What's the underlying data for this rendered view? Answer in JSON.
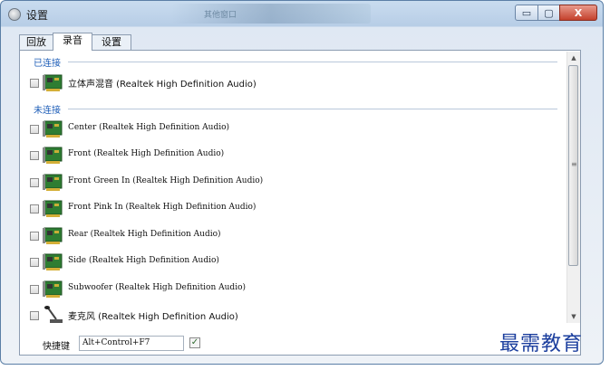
{
  "window": {
    "title": "设置",
    "blurred_title": "其他窗口"
  },
  "controls": {
    "minimize": "▭",
    "maximize": "▢",
    "close": "X"
  },
  "tabs": [
    {
      "label": "回放",
      "active": false
    },
    {
      "label": "录音",
      "active": true
    },
    {
      "label": "设置",
      "active": false
    }
  ],
  "groups": {
    "connected": "已连接",
    "disconnected": "未连接"
  },
  "devices": {
    "connected": [
      {
        "label": "立体声混音 (Realtek High Definition Audio)",
        "icon": "sound-card-icon"
      }
    ],
    "disconnected": [
      {
        "label": "Center (Realtek High Definition Audio)",
        "icon": "sound-card-icon"
      },
      {
        "label": "Front (Realtek High Definition Audio)",
        "icon": "sound-card-icon"
      },
      {
        "label": "Front Green In (Realtek High Definition Audio)",
        "icon": "sound-card-icon"
      },
      {
        "label": "Front Pink In (Realtek High Definition Audio)",
        "icon": "sound-card-icon"
      },
      {
        "label": "Rear (Realtek High Definition Audio)",
        "icon": "sound-card-icon"
      },
      {
        "label": "Side (Realtek High Definition Audio)",
        "icon": "sound-card-icon"
      },
      {
        "label": "Subwoofer (Realtek High Definition Audio)",
        "icon": "sound-card-icon"
      },
      {
        "label": "麦克风 (Realtek High Definition Audio)",
        "icon": "microphone-icon"
      }
    ]
  },
  "hotkey": {
    "label": "快捷键",
    "value": "Alt+Control+F7",
    "enabled": true
  },
  "watermark": "最需教育",
  "colors": {
    "group_label": "#1e5eb8",
    "watermark": "#1c3f9e"
  }
}
